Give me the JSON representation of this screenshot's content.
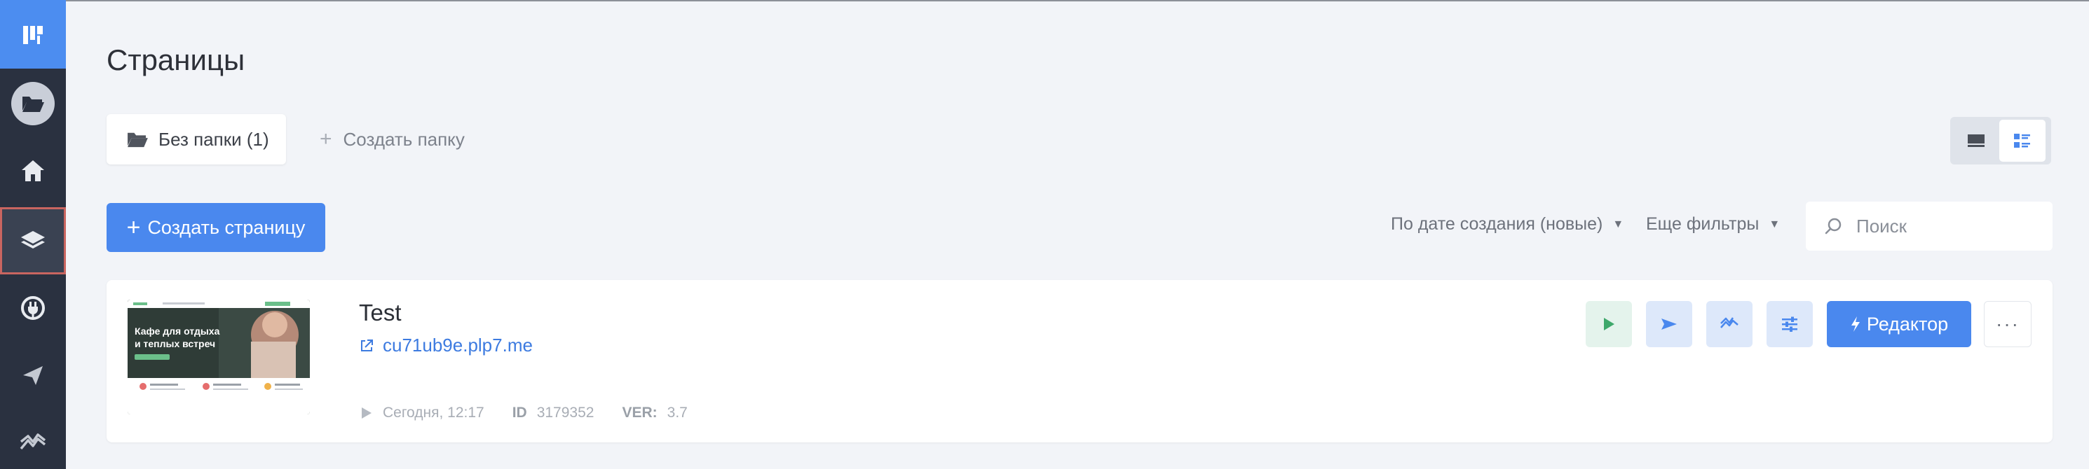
{
  "sidebar": {
    "logo_icon": "lp-logo-icon",
    "items": [
      {
        "name": "folder-icon"
      },
      {
        "name": "home-icon"
      },
      {
        "name": "layers-icon",
        "active": true
      },
      {
        "name": "integration-icon"
      },
      {
        "name": "send-icon"
      },
      {
        "name": "analytics-icon"
      }
    ]
  },
  "header": {
    "title": "Страницы"
  },
  "folders": {
    "current": "Без папки (1)",
    "create_label": "Создать папку"
  },
  "toolbar": {
    "create_page_label": "Создать страницу",
    "sort_label": "По дате создания (новые)",
    "filters_label": "Еще фильтры",
    "search_placeholder": "Поиск",
    "view_modes": [
      "grid-view",
      "list-view"
    ],
    "active_view": "list-view"
  },
  "page_card": {
    "name": "Test",
    "domain": "cu71ub9e.plp7.me",
    "date": "Сегодня, 12:17",
    "id_label": "ID",
    "id_value": "3179352",
    "ver_label": "VER:",
    "ver_value": "3.7",
    "thumbnail_heading": "Кафе для отдыха и теплых встреч",
    "editor_label": "Редактор",
    "more_label": "···"
  },
  "colors": {
    "accent": "#4a88ee",
    "sidebar_bg": "#2a3140",
    "background": "#f2f4f8",
    "active_outline": "#c96560"
  }
}
